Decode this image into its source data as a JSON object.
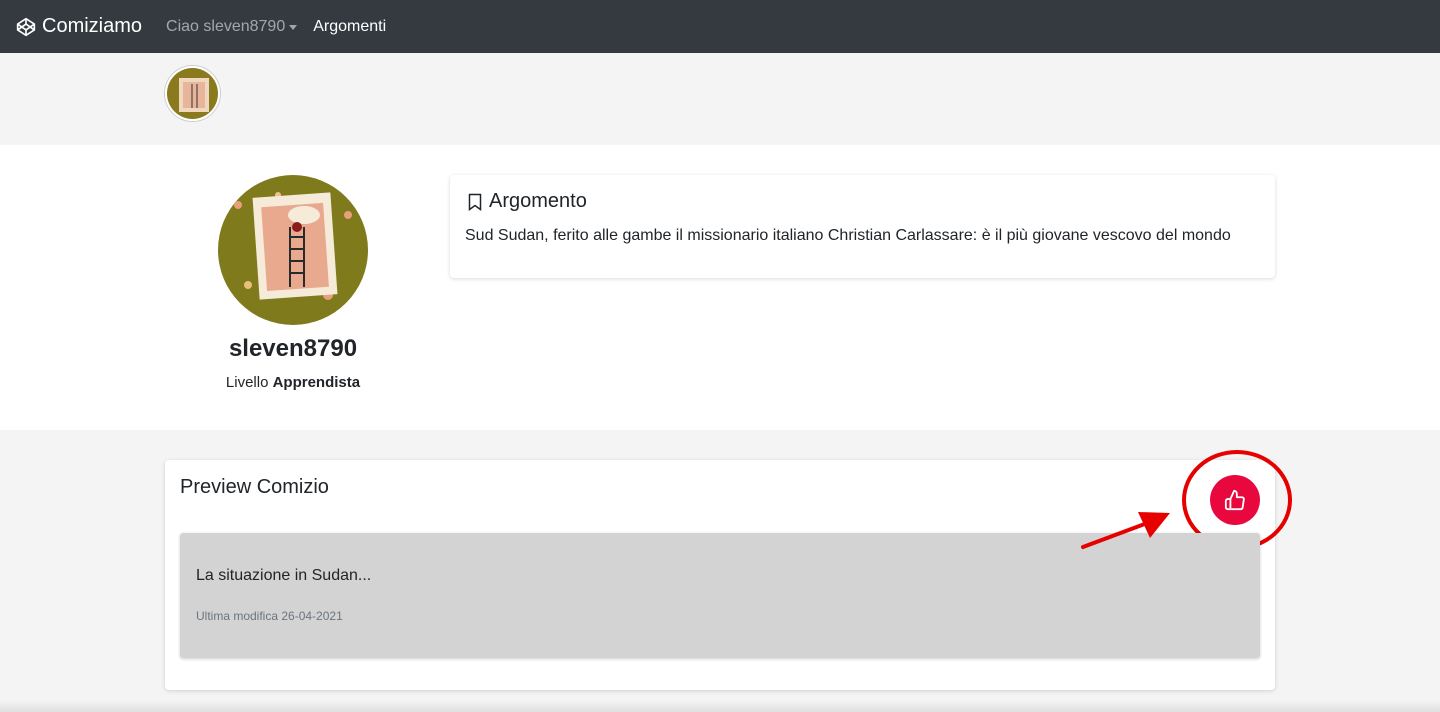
{
  "navbar": {
    "brand": "Comiziamo",
    "user_menu": "Ciao sleven8790",
    "link": "Argomenti"
  },
  "profile": {
    "username": "sleven8790",
    "level_label": "Livello",
    "level_value": "Apprendista"
  },
  "topic": {
    "title": "Argomento",
    "text": "Sud Sudan, ferito alle gambe il missionario italiano Christian Carlassare: è il più giovane vescovo del mondo"
  },
  "preview": {
    "title": "Preview Comizio",
    "item_title": "La situazione in Sudan...",
    "item_date": "Ultima modifica 26-04-2021"
  },
  "icons": {
    "brand": "codepen-cube-icon",
    "topic": "bookmark-icon",
    "like": "thumbs-up-icon"
  },
  "colors": {
    "navbar": "#343a40",
    "like_button": "#e8083e",
    "annotation": "#e60000"
  }
}
